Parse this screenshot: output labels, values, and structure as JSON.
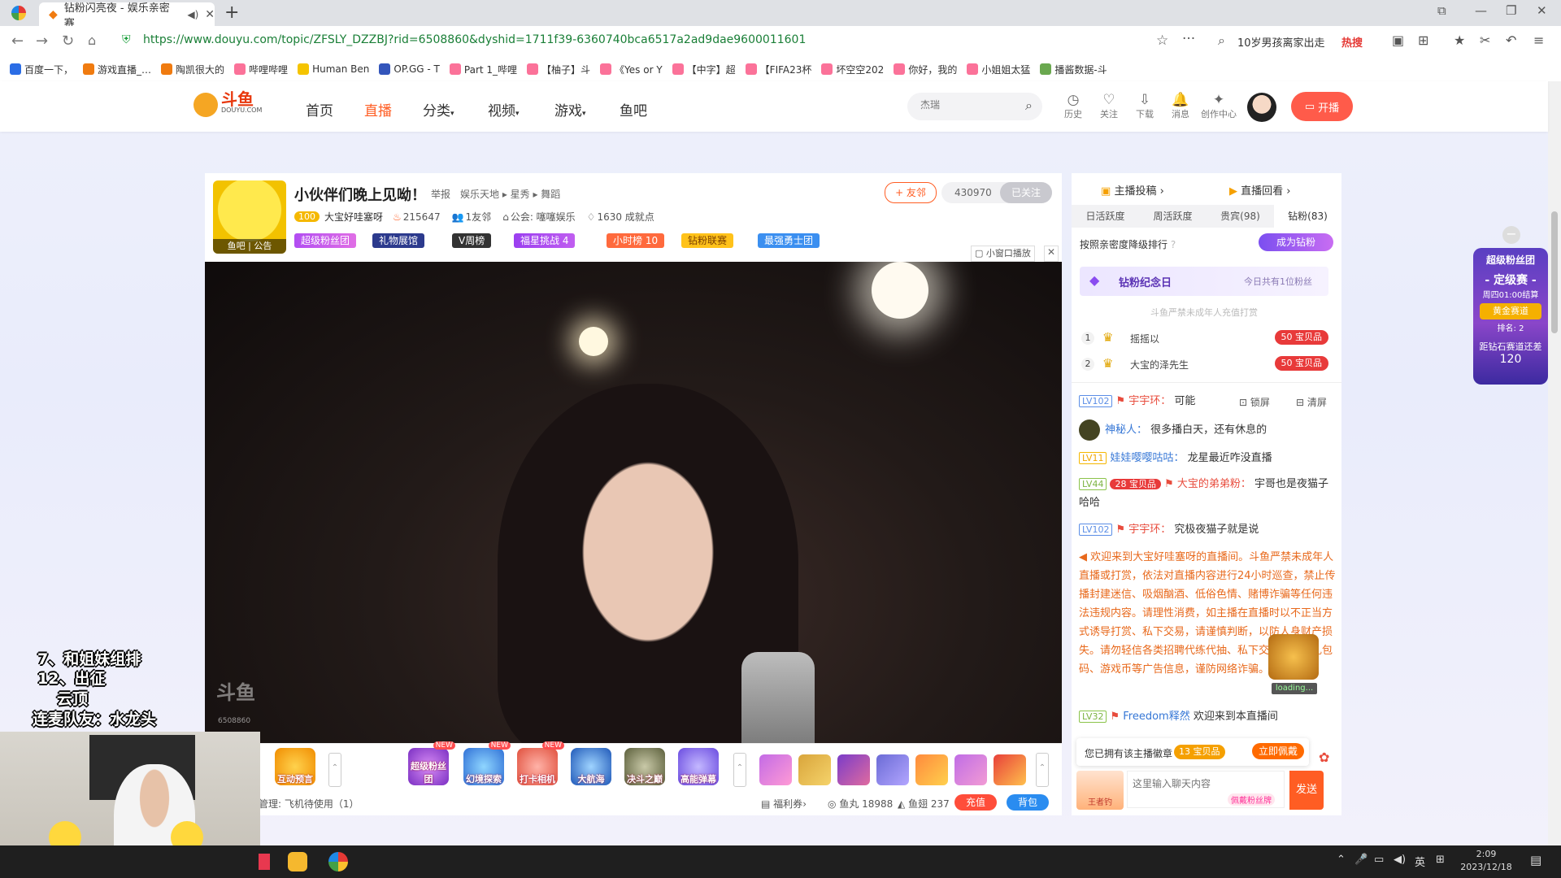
{
  "browser": {
    "tab_title": "钻粉闪亮夜 - 娱乐亲密赛",
    "new_tab": "+",
    "url": "https://www.douyu.com/topic/ZFSLY_DZZBJ?rid=6508860&dyshid=1711f39-6360740bca6517a2ad9dae9600011601",
    "search_hint": "10岁男孩离家出走",
    "hot_label": "热搜",
    "bookmarks": [
      "百度一下，",
      "游戏直播_…",
      "陶凯很大的",
      "哔哩哔哩",
      "Human Ben",
      "OP.GG - T",
      "Part 1_哔哩",
      "【柚子】斗",
      "《Yes or Y",
      "【中字】超",
      "【FIFA23杯",
      "坏空空202",
      "你好，我的",
      "小姐姐太猛",
      "播酱数据-斗"
    ]
  },
  "site": {
    "logo_text": "斗鱼",
    "logo_sub": "DOUYU.COM",
    "nav": [
      "首页",
      "直播",
      "分类",
      "视频",
      "游戏",
      "鱼吧"
    ],
    "search_placeholder": "杰瑞",
    "icons": [
      {
        "label": "历史",
        "glyph": "◷"
      },
      {
        "label": "关注",
        "glyph": "♡"
      },
      {
        "label": "下载",
        "glyph": "⇩"
      },
      {
        "label": "消息",
        "glyph": "🔔"
      },
      {
        "label": "创作中心",
        "glyph": "✦"
      }
    ],
    "broadcast_btn": "开播"
  },
  "room": {
    "title": "小伙伴们晚上见呦！",
    "report": "举报",
    "breadcrumb": "娱乐天地 ▸ 星秀 ▸ 舞蹈",
    "badge_level": "100",
    "streamer": "大宝好哇塞呀",
    "hot": "215647",
    "friends": "1友邻",
    "guild": "公会: 噻噻娱乐",
    "achievements": "1630 成就点",
    "fish_bar": "鱼吧",
    "notice": "公告",
    "add_friend": "+ 友邻",
    "followers": "430970",
    "followed": "已关注",
    "tags": [
      "超级粉丝团",
      "礼物展馆",
      "V周榜",
      "福星挑战 4",
      "小时榜 10",
      "钻粉联赛",
      "最强勇士团"
    ],
    "mini_player": "小窗口播放",
    "watermark": "斗鱼",
    "watermark_room": "6508860"
  },
  "gifts": {
    "items": [
      "互动预言",
      "超级粉丝团",
      "幻境探索",
      "打卡相机",
      "大航海",
      "决斗之巅",
      "高能弹幕"
    ],
    "new_badge": "NEW",
    "manage_text": "管理: 飞机待使用（1）",
    "welfare": "福利券",
    "fish_balls": "鱼丸 18988",
    "fish_fins": "鱼翅 237",
    "recharge": "充值",
    "backpack": "背包"
  },
  "panel": {
    "tabs_top": [
      "主播投稿",
      "直播回看"
    ],
    "tabs": [
      "日活跃度",
      "周活跃度",
      "贵宾(98)",
      "钻粉(83)"
    ],
    "rank_label": "按照亲密度降级排行",
    "become_diamond": "成为钻粉",
    "anniv_title": "钻粉纪念日",
    "anniv_today": "今日共有1位粉丝",
    "notice": "斗鱼严禁未成年人充值打赏",
    "rank": [
      {
        "no": "1",
        "name": "摇摇以",
        "level": "50",
        "badge": "宝贝品"
      },
      {
        "no": "2",
        "name": "大宝的泽先生",
        "level": "50",
        "badge": "宝贝品"
      }
    ],
    "lock_screen": "锁屏",
    "clear_screen": "清屏",
    "loading": "loading...",
    "send_btn": "发送",
    "chat_placeholder": "这里输入聊天内容",
    "own_badge_text": "您已拥有该主播徽章",
    "own_badge_level": "13",
    "own_badge_name": "宝贝品",
    "wear_now": "立即佩戴",
    "king_label": "王者钓",
    "silent_badge": "佩戴粉丝牌"
  },
  "chat": [
    {
      "lv": "LV102",
      "name": "宇宇环：",
      "text": "可能"
    },
    {
      "lv": "",
      "name": "神秘人：",
      "text": "很多播白天，还有休息的"
    },
    {
      "lv": "LV11",
      "name": "娃娃嘤嘤咕咕：",
      "text": "龙星最近咋没直播"
    },
    {
      "lv": "LV44",
      "name": "大宝的弟弟粉：",
      "text": "宇哥也是夜猫子哈哈",
      "badge_level": "28",
      "badge_name": "宝贝品"
    },
    {
      "lv": "LV102",
      "name": "宇宇环：",
      "text": "究极夜猫子就是说"
    },
    {
      "lv": "LV32",
      "name": "Freedom释然",
      "text": "欢迎来到本直播间"
    }
  ],
  "system_msg": "欢迎来到大宝好哇塞呀的直播间。斗鱼严禁未成年人直播或打赏，依法对直播内容进行24小时巡查，禁止传播封建迷信、吸烟酗酒、低俗色情、赌博诈骗等任何违法违规内容。请理性消费，如主播在直播时以不正当方式诱导打赏、私下交易，请谨慎判断，以防人身财产损失。请勿轻信各类招聘代练代抽、私下交易、购买礼包码、游戏币等广告信息，谨防网络诈骗。",
  "fan_widget": {
    "title": "超级粉丝团",
    "stage": "- 定级赛 -",
    "time": "周四01:00结算",
    "tier": "黄金赛道",
    "rank": "排名: 2",
    "gap_label": "距钻石赛道还差",
    "gap": "120"
  },
  "overlay": {
    "lines": [
      "7、和姐妹组排",
      "12、出征",
      "云顶",
      "连麦队友：水龙头"
    ]
  },
  "taskbar": {
    "ime": "英",
    "time": "2:09",
    "date": "2023/12/18"
  }
}
